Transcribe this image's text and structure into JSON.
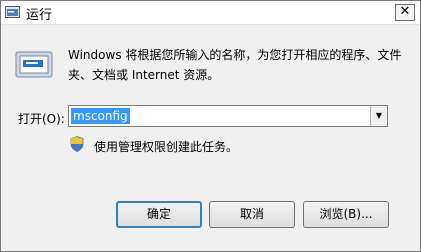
{
  "window": {
    "title": "运行",
    "icon": "run-app-icon",
    "close_glyph": "✕"
  },
  "description": "Windows 将根据您所输入的名称，为您打开相应的程序、文件夹、文档或 Internet 资源。",
  "open_field": {
    "label": "打开(O):",
    "value": "msconfig",
    "dropdown_glyph": "▼"
  },
  "admin_note": "使用管理权限创建此任务。",
  "buttons": {
    "ok": "确定",
    "cancel": "取消",
    "browse": "浏览(B)..."
  },
  "colors": {
    "selection": "#3399ff",
    "dialog_bg": "#f0f0f0",
    "default_button_border": "#3c7fb1"
  }
}
